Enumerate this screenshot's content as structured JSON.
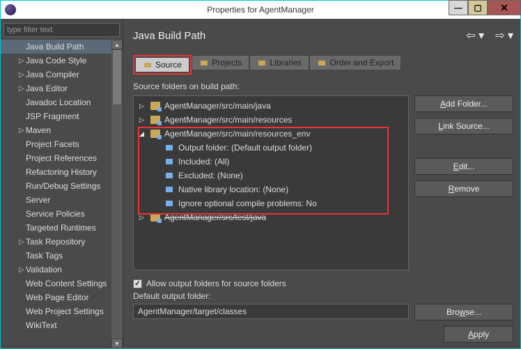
{
  "title": "Properties for AgentManager",
  "filter_placeholder": "type filter text",
  "sidebar": {
    "items": [
      {
        "label": "Java Build Path",
        "tw": "",
        "selected": true,
        "indent": true
      },
      {
        "label": "Java Code Style",
        "tw": "▷"
      },
      {
        "label": "Java Compiler",
        "tw": "▷"
      },
      {
        "label": "Java Editor",
        "tw": "▷"
      },
      {
        "label": "Javadoc Location",
        "tw": ""
      },
      {
        "label": "JSP Fragment",
        "tw": ""
      },
      {
        "label": "Maven",
        "tw": "▷"
      },
      {
        "label": "Project Facets",
        "tw": ""
      },
      {
        "label": "Project References",
        "tw": ""
      },
      {
        "label": "Refactoring History",
        "tw": ""
      },
      {
        "label": "Run/Debug Settings",
        "tw": ""
      },
      {
        "label": "Server",
        "tw": ""
      },
      {
        "label": "Service Policies",
        "tw": ""
      },
      {
        "label": "Targeted Runtimes",
        "tw": ""
      },
      {
        "label": "Task Repository",
        "tw": "▷"
      },
      {
        "label": "Task Tags",
        "tw": ""
      },
      {
        "label": "Validation",
        "tw": "▷"
      },
      {
        "label": "Web Content Settings",
        "tw": ""
      },
      {
        "label": "Web Page Editor",
        "tw": ""
      },
      {
        "label": "Web Project Settings",
        "tw": ""
      },
      {
        "label": "WikiText",
        "tw": ""
      }
    ]
  },
  "main": {
    "title": "Java Build Path",
    "tabs": [
      {
        "label": "Source",
        "active": true,
        "icon": "source"
      },
      {
        "label": "Projects",
        "active": false,
        "icon": "projects"
      },
      {
        "label": "Libraries",
        "active": false,
        "icon": "libraries"
      },
      {
        "label": "Order and Export",
        "active": false,
        "icon": "order"
      }
    ],
    "path_label": "Source folders on build path:",
    "source_tree": [
      {
        "level": 0,
        "tw": "▷",
        "kind": "folder",
        "label": "AgentManager/src/main/java"
      },
      {
        "level": 0,
        "tw": "▷",
        "kind": "folder",
        "label": "AgentManager/src/main/resources"
      },
      {
        "level": 0,
        "tw": "◢",
        "kind": "folder",
        "label": "AgentManager/src/main/resources_env"
      },
      {
        "level": 1,
        "tw": "",
        "kind": "output",
        "label": "Output folder: (Default output folder)"
      },
      {
        "level": 1,
        "tw": "",
        "kind": "include",
        "label": "Included: (All)"
      },
      {
        "level": 1,
        "tw": "",
        "kind": "exclude",
        "label": "Excluded: (None)"
      },
      {
        "level": 1,
        "tw": "",
        "kind": "native",
        "label": "Native library location: (None)"
      },
      {
        "level": 1,
        "tw": "",
        "kind": "ignore",
        "label": "Ignore optional compile problems: No"
      },
      {
        "level": 0,
        "tw": "▷",
        "kind": "folder-struck",
        "label": "AgentManager/src/test/java"
      }
    ],
    "buttons": {
      "add_folder": "Add Folder...",
      "link_source": "Link Source...",
      "edit": "Edit...",
      "remove": "Remove"
    },
    "allow_output": "Allow output folders for source folders",
    "default_output_label": "Default output folder:",
    "default_output_value": "AgentManager/target/classes",
    "browse": "Browse...",
    "apply": "Apply"
  }
}
